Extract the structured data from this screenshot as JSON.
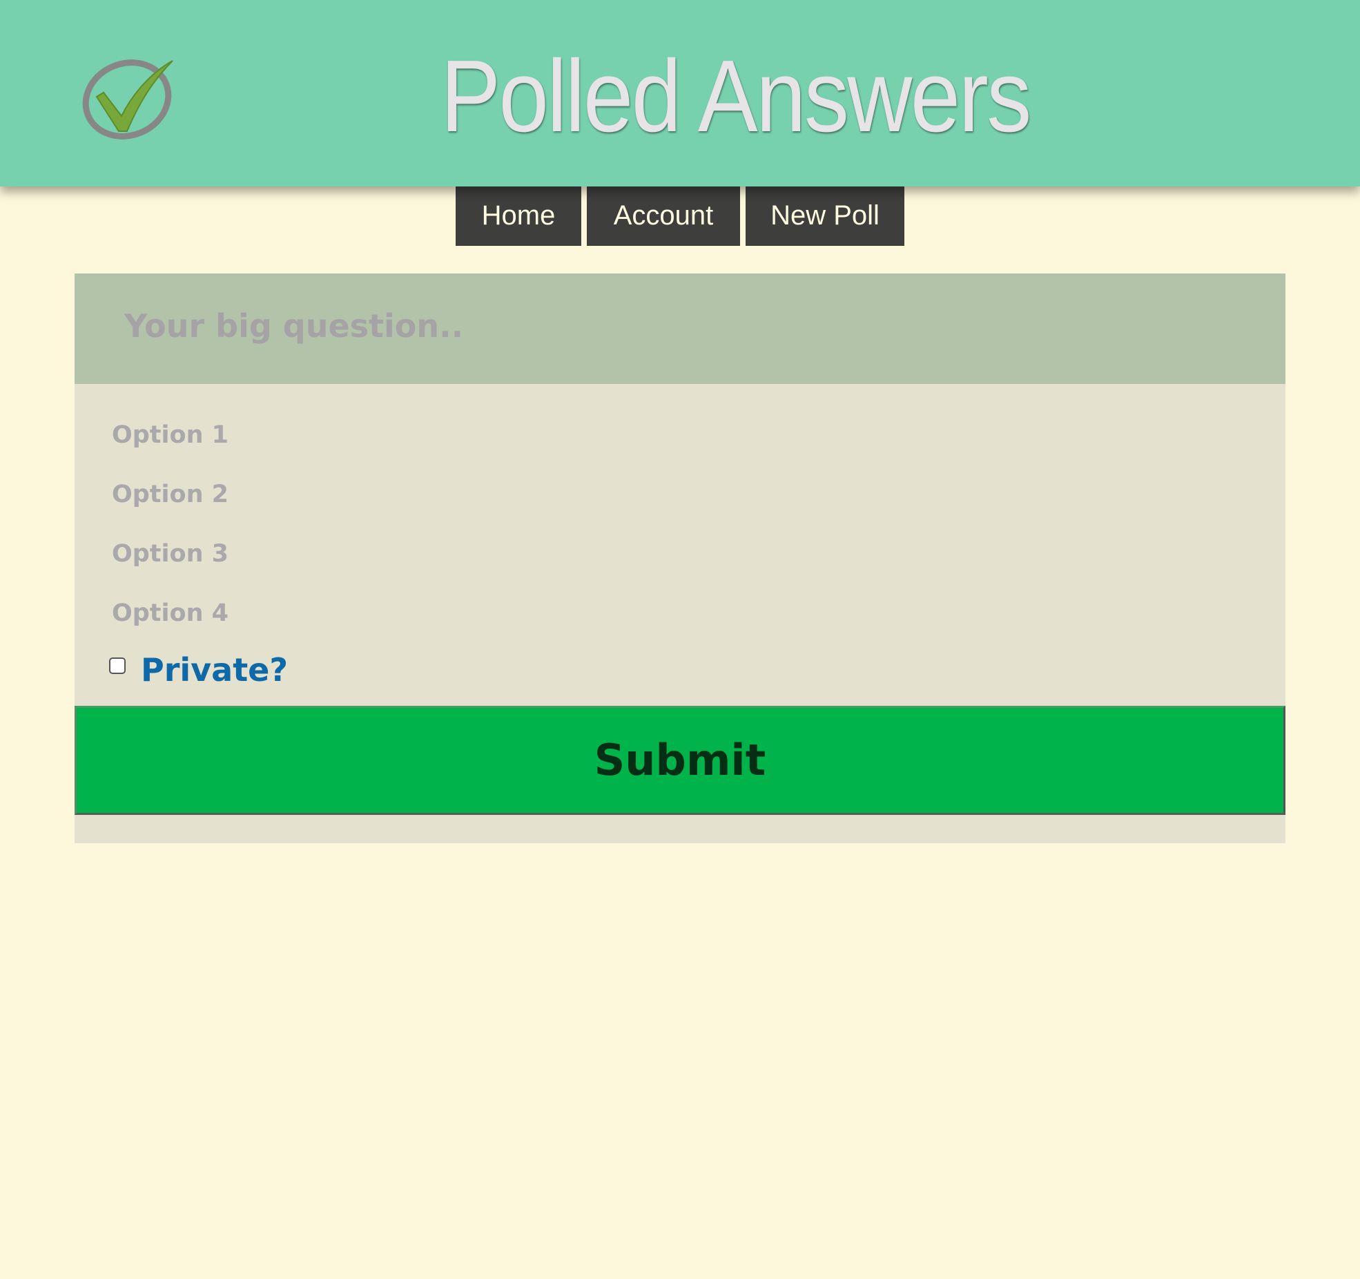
{
  "header": {
    "title": "Polled Answers",
    "logo_icon": "checkmark-circle-icon"
  },
  "nav": {
    "items": [
      {
        "label": "Home"
      },
      {
        "label": "Account"
      },
      {
        "label": "New Poll"
      }
    ]
  },
  "form": {
    "question": {
      "placeholder": "Your big question..",
      "value": ""
    },
    "options": [
      {
        "placeholder": "Option 1",
        "value": ""
      },
      {
        "placeholder": "Option 2",
        "value": ""
      },
      {
        "placeholder": "Option 3",
        "value": ""
      },
      {
        "placeholder": "Option 4",
        "value": ""
      }
    ],
    "private_label": "Private?",
    "private_checked": false,
    "submit_label": "Submit"
  },
  "colors": {
    "header_bg": "#77d0ae",
    "page_bg": "#fdf8dc",
    "nav_bg": "#3e3e3d",
    "question_bg": "#b3c3a9",
    "panel_bg": "#e4e1cf",
    "submit_bg": "#00b34a",
    "private_label": "#0d69a7"
  }
}
